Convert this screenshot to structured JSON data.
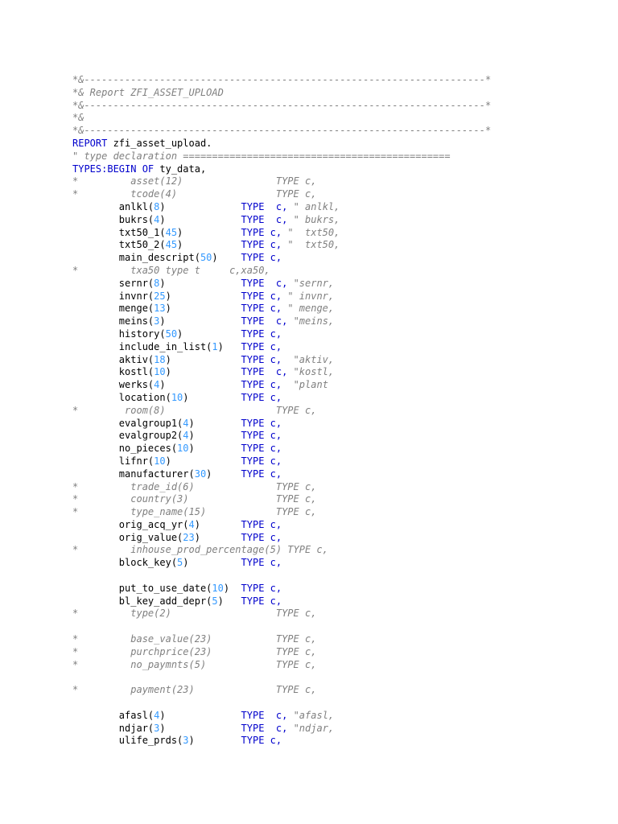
{
  "lines": [
    [
      {
        "t": "*&---------------------------------------------------------------------*",
        "c": "cm"
      }
    ],
    [
      {
        "t": "*& Report ZFI_ASSET_UPLOAD",
        "c": "cm"
      }
    ],
    [
      {
        "t": "*&---------------------------------------------------------------------*",
        "c": "cm"
      }
    ],
    [
      {
        "t": "*&",
        "c": "cm"
      }
    ],
    [
      {
        "t": "*&---------------------------------------------------------------------*",
        "c": "cm"
      }
    ],
    [
      {
        "t": "REPORT",
        "c": "kw"
      },
      {
        "t": " zfi_asset_upload.",
        "c": "sp"
      }
    ],
    [
      {
        "t": "\" type declaration ==============================================",
        "c": "cm"
      }
    ],
    [
      {
        "t": "TYPES:BEGIN OF",
        "c": "kw"
      },
      {
        "t": " ty_data,",
        "c": "sp"
      }
    ],
    [
      {
        "t": "*         asset(12)                TYPE c,",
        "c": "cm"
      }
    ],
    [
      {
        "t": "*         tcode(4)                 TYPE c,",
        "c": "cm"
      }
    ],
    [
      {
        "t": "        anlkl(",
        "c": "sp"
      },
      {
        "t": "8",
        "c": "nm"
      },
      {
        "t": ")             ",
        "c": "sp"
      },
      {
        "t": "TYPE  c,",
        "c": "kw"
      },
      {
        "t": " \" anlkl,",
        "c": "cm"
      }
    ],
    [
      {
        "t": "        bukrs(",
        "c": "sp"
      },
      {
        "t": "4",
        "c": "nm"
      },
      {
        "t": ")             ",
        "c": "sp"
      },
      {
        "t": "TYPE  c,",
        "c": "kw"
      },
      {
        "t": " \" bukrs,",
        "c": "cm"
      }
    ],
    [
      {
        "t": "        txt50_1(",
        "c": "sp"
      },
      {
        "t": "45",
        "c": "nm"
      },
      {
        "t": ")          ",
        "c": "sp"
      },
      {
        "t": "TYPE c,",
        "c": "kw"
      },
      {
        "t": " \"  txt50,",
        "c": "cm"
      }
    ],
    [
      {
        "t": "        txt50_2(",
        "c": "sp"
      },
      {
        "t": "45",
        "c": "nm"
      },
      {
        "t": ")          ",
        "c": "sp"
      },
      {
        "t": "TYPE c,",
        "c": "kw"
      },
      {
        "t": " \"  txt50,",
        "c": "cm"
      }
    ],
    [
      {
        "t": "        main_descript(",
        "c": "sp"
      },
      {
        "t": "50",
        "c": "nm"
      },
      {
        "t": ")    ",
        "c": "sp"
      },
      {
        "t": "TYPE c,",
        "c": "kw"
      }
    ],
    [
      {
        "t": "*         txa50 type t     c,xa50,",
        "c": "cm"
      }
    ],
    [
      {
        "t": "        sernr(",
        "c": "sp"
      },
      {
        "t": "8",
        "c": "nm"
      },
      {
        "t": ")             ",
        "c": "sp"
      },
      {
        "t": "TYPE  c,",
        "c": "kw"
      },
      {
        "t": " \"sernr,",
        "c": "cm"
      }
    ],
    [
      {
        "t": "        invnr(",
        "c": "sp"
      },
      {
        "t": "25",
        "c": "nm"
      },
      {
        "t": ")            ",
        "c": "sp"
      },
      {
        "t": "TYPE c,",
        "c": "kw"
      },
      {
        "t": " \" invnr,",
        "c": "cm"
      }
    ],
    [
      {
        "t": "        menge(",
        "c": "sp"
      },
      {
        "t": "13",
        "c": "nm"
      },
      {
        "t": ")            ",
        "c": "sp"
      },
      {
        "t": "TYPE c,",
        "c": "kw"
      },
      {
        "t": " \" menge,",
        "c": "cm"
      }
    ],
    [
      {
        "t": "        meins(",
        "c": "sp"
      },
      {
        "t": "3",
        "c": "nm"
      },
      {
        "t": ")             ",
        "c": "sp"
      },
      {
        "t": "TYPE  c,",
        "c": "kw"
      },
      {
        "t": " \"meins,",
        "c": "cm"
      }
    ],
    [
      {
        "t": "        history(",
        "c": "sp"
      },
      {
        "t": "50",
        "c": "nm"
      },
      {
        "t": ")          ",
        "c": "sp"
      },
      {
        "t": "TYPE c,",
        "c": "kw"
      }
    ],
    [
      {
        "t": "        include_in_list(",
        "c": "sp"
      },
      {
        "t": "1",
        "c": "nm"
      },
      {
        "t": ")   ",
        "c": "sp"
      },
      {
        "t": "TYPE c,",
        "c": "kw"
      }
    ],
    [
      {
        "t": "        aktiv(",
        "c": "sp"
      },
      {
        "t": "18",
        "c": "nm"
      },
      {
        "t": ")            ",
        "c": "sp"
      },
      {
        "t": "TYPE c,",
        "c": "kw"
      },
      {
        "t": "  \"aktiv,",
        "c": "cm"
      }
    ],
    [
      {
        "t": "        kostl(",
        "c": "sp"
      },
      {
        "t": "10",
        "c": "nm"
      },
      {
        "t": ")            ",
        "c": "sp"
      },
      {
        "t": "TYPE  c,",
        "c": "kw"
      },
      {
        "t": " \"kostl,",
        "c": "cm"
      }
    ],
    [
      {
        "t": "        werks(",
        "c": "sp"
      },
      {
        "t": "4",
        "c": "nm"
      },
      {
        "t": ")             ",
        "c": "sp"
      },
      {
        "t": "TYPE c,",
        "c": "kw"
      },
      {
        "t": "  \"plant",
        "c": "cm"
      }
    ],
    [
      {
        "t": "        location(",
        "c": "sp"
      },
      {
        "t": "10",
        "c": "nm"
      },
      {
        "t": ")         ",
        "c": "sp"
      },
      {
        "t": "TYPE c,",
        "c": "kw"
      }
    ],
    [
      {
        "t": "*        room(8)                   TYPE c,",
        "c": "cm"
      }
    ],
    [
      {
        "t": "        evalgroup1(",
        "c": "sp"
      },
      {
        "t": "4",
        "c": "nm"
      },
      {
        "t": ")        ",
        "c": "sp"
      },
      {
        "t": "TYPE c,",
        "c": "kw"
      }
    ],
    [
      {
        "t": "        evalgroup2(",
        "c": "sp"
      },
      {
        "t": "4",
        "c": "nm"
      },
      {
        "t": ")        ",
        "c": "sp"
      },
      {
        "t": "TYPE c,",
        "c": "kw"
      }
    ],
    [
      {
        "t": "        no_pieces(",
        "c": "sp"
      },
      {
        "t": "10",
        "c": "nm"
      },
      {
        "t": ")        ",
        "c": "sp"
      },
      {
        "t": "TYPE c,",
        "c": "kw"
      }
    ],
    [
      {
        "t": "        lifnr(",
        "c": "sp"
      },
      {
        "t": "10",
        "c": "nm"
      },
      {
        "t": ")            ",
        "c": "sp"
      },
      {
        "t": "TYPE c,",
        "c": "kw"
      }
    ],
    [
      {
        "t": "        manufacturer(",
        "c": "sp"
      },
      {
        "t": "30",
        "c": "nm"
      },
      {
        "t": ")     ",
        "c": "sp"
      },
      {
        "t": "TYPE c,",
        "c": "kw"
      }
    ],
    [
      {
        "t": "*         trade_id(6)              TYPE c,",
        "c": "cm"
      }
    ],
    [
      {
        "t": "*         country(3)               TYPE c,",
        "c": "cm"
      }
    ],
    [
      {
        "t": "*         type_name(15)            TYPE c,",
        "c": "cm"
      }
    ],
    [
      {
        "t": "        orig_acq_yr(",
        "c": "sp"
      },
      {
        "t": "4",
        "c": "nm"
      },
      {
        "t": ")       ",
        "c": "sp"
      },
      {
        "t": "TYPE c,",
        "c": "kw"
      }
    ],
    [
      {
        "t": "        orig_value(",
        "c": "sp"
      },
      {
        "t": "23",
        "c": "nm"
      },
      {
        "t": ")       ",
        "c": "sp"
      },
      {
        "t": "TYPE c,",
        "c": "kw"
      }
    ],
    [
      {
        "t": "*         inhouse_prod_percentage(5) TYPE c,",
        "c": "cm"
      }
    ],
    [
      {
        "t": "        block_key(",
        "c": "sp"
      },
      {
        "t": "5",
        "c": "nm"
      },
      {
        "t": ")         ",
        "c": "sp"
      },
      {
        "t": "TYPE c,",
        "c": "kw"
      }
    ],
    [],
    [
      {
        "t": "        put_to_use_date(",
        "c": "sp"
      },
      {
        "t": "10",
        "c": "nm"
      },
      {
        "t": ")  ",
        "c": "sp"
      },
      {
        "t": "TYPE c,",
        "c": "kw"
      }
    ],
    [
      {
        "t": "        bl_key_add_depr(",
        "c": "sp"
      },
      {
        "t": "5",
        "c": "nm"
      },
      {
        "t": ")   ",
        "c": "sp"
      },
      {
        "t": "TYPE c,",
        "c": "kw"
      }
    ],
    [
      {
        "t": "*         type(2)                  TYPE c,",
        "c": "cm"
      }
    ],
    [],
    [
      {
        "t": "*         base_value(23)           TYPE c,",
        "c": "cm"
      }
    ],
    [
      {
        "t": "*         purchprice(23)           TYPE c,",
        "c": "cm"
      }
    ],
    [
      {
        "t": "*         no_paymnts(5)            TYPE c,",
        "c": "cm"
      }
    ],
    [],
    [
      {
        "t": "*         payment(23)              TYPE c,",
        "c": "cm"
      }
    ],
    [],
    [
      {
        "t": "        afasl(",
        "c": "sp"
      },
      {
        "t": "4",
        "c": "nm"
      },
      {
        "t": ")             ",
        "c": "sp"
      },
      {
        "t": "TYPE  c,",
        "c": "kw"
      },
      {
        "t": " \"afasl,",
        "c": "cm"
      }
    ],
    [
      {
        "t": "        ndjar(",
        "c": "sp"
      },
      {
        "t": "3",
        "c": "nm"
      },
      {
        "t": ")             ",
        "c": "sp"
      },
      {
        "t": "TYPE  c,",
        "c": "kw"
      },
      {
        "t": " \"ndjar,",
        "c": "cm"
      }
    ],
    [
      {
        "t": "        ulife_prds(",
        "c": "sp"
      },
      {
        "t": "3",
        "c": "nm"
      },
      {
        "t": ")        ",
        "c": "sp"
      },
      {
        "t": "TYPE c,",
        "c": "kw"
      }
    ]
  ]
}
